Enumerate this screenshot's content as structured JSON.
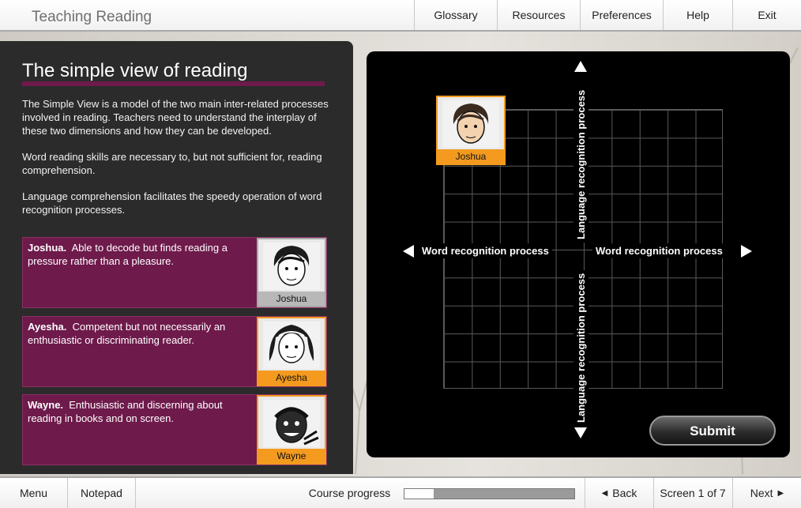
{
  "app": {
    "title": "Teaching Reading"
  },
  "topnav": [
    {
      "label": "Glossary"
    },
    {
      "label": "Resources"
    },
    {
      "label": "Preferences"
    },
    {
      "label": "Help"
    },
    {
      "label": "Exit"
    }
  ],
  "panel": {
    "title": "The simple view of reading",
    "intro": [
      "The Simple View is a model of the two main inter-related processes involved in reading. Teachers need to understand the interplay of these two dimensions and how they can be developed.",
      "Word reading skills are necessary to, but not sufficient for, reading comprehension.",
      "Language comprehension facilitates the speedy operation of word recognition processes."
    ],
    "cards": [
      {
        "name": "Joshua.",
        "desc": "Able to decode but finds reading a pressure rather than a pleasure.",
        "caption": "Joshua"
      },
      {
        "name": "Ayesha.",
        "desc": "Competent but not necessarily an enthusiastic or discriminating reader.",
        "caption": "Ayesha"
      },
      {
        "name": "Wayne.",
        "desc": "Enthusiastic and discerning about reading in books and on screen.",
        "caption": "Wayne"
      }
    ]
  },
  "board": {
    "axis_left": "Word recognition process",
    "axis_right": "Word recognition process",
    "axis_top": "Language recognition process",
    "axis_bottom": "Language recognition process",
    "placed_card": "Joshua",
    "submit": "Submit"
  },
  "bottombar": {
    "menu": "Menu",
    "notepad": "Notepad",
    "progress_label": "Course progress",
    "progress": 0.17,
    "back": "Back",
    "screen": "Screen 1 of 7",
    "next": "Next"
  },
  "colors": {
    "accent": "#6e1a4b",
    "highlight": "#f39a1f",
    "board": "#000000"
  }
}
